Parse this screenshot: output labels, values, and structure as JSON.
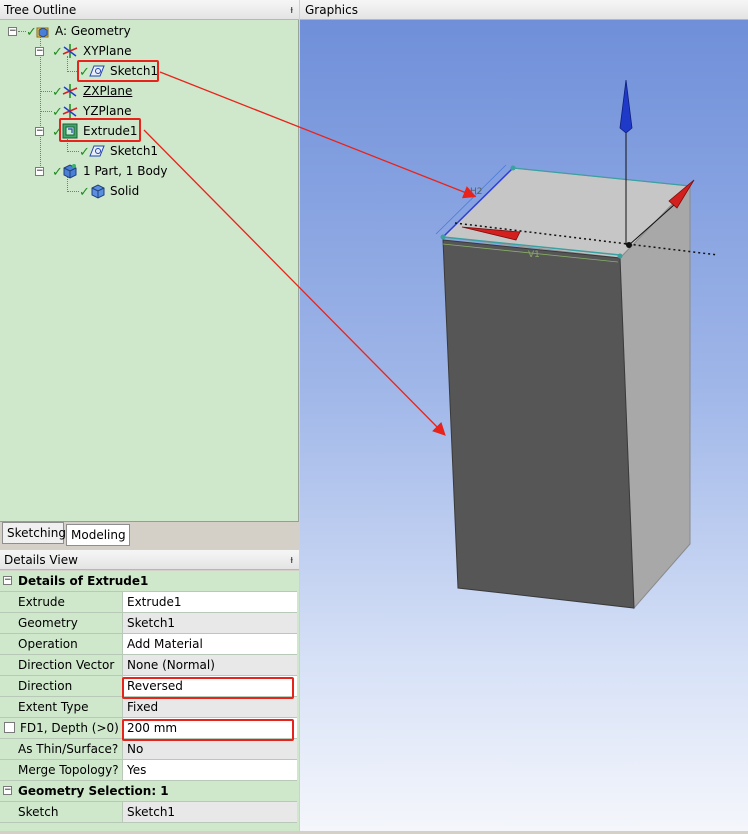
{
  "tree_outline": {
    "title": "Tree Outline",
    "pin": "ᵼ",
    "nodes": {
      "geometry": "A: Geometry",
      "xyplane": "XYPlane",
      "sketch1_xy": "Sketch1",
      "zxplane": "ZXPlane",
      "yzplane": "YZPlane",
      "extrude1": "Extrude1",
      "sketch1_ext": "Sketch1",
      "part": "1 Part, 1 Body",
      "solid": "Solid"
    }
  },
  "tabs": {
    "sketching": "Sketching",
    "modeling": "Modeling"
  },
  "details": {
    "title": "Details View",
    "pin": "ᵼ",
    "section1": "Details of Extrude1",
    "rows": [
      {
        "key": "Extrude",
        "value": "Extrude1"
      },
      {
        "key": "Geometry",
        "value": "Sketch1"
      },
      {
        "key": "Operation",
        "value": "Add Material"
      },
      {
        "key": "Direction Vector",
        "value": "None (Normal)"
      },
      {
        "key": "Direction",
        "value": "Reversed"
      },
      {
        "key": "Extent Type",
        "value": "Fixed"
      },
      {
        "key": "FD1,  Depth (>0)",
        "value": "200 mm"
      },
      {
        "key": "As Thin/Surface?",
        "value": "No"
      },
      {
        "key": "Merge Topology?",
        "value": "Yes"
      }
    ],
    "section2": "Geometry Selection: 1",
    "sketch_row": {
      "key": "Sketch",
      "value": "Sketch1"
    }
  },
  "graphics": {
    "title": "Graphics",
    "dim_h": "H2",
    "dim_v": "V1"
  },
  "colors": {
    "tree_bg": "#cfe8cc",
    "highlight": "#e8231b",
    "box_front": "#565656",
    "box_side": "#a8a8a8",
    "box_top": "#c6c6c6"
  }
}
